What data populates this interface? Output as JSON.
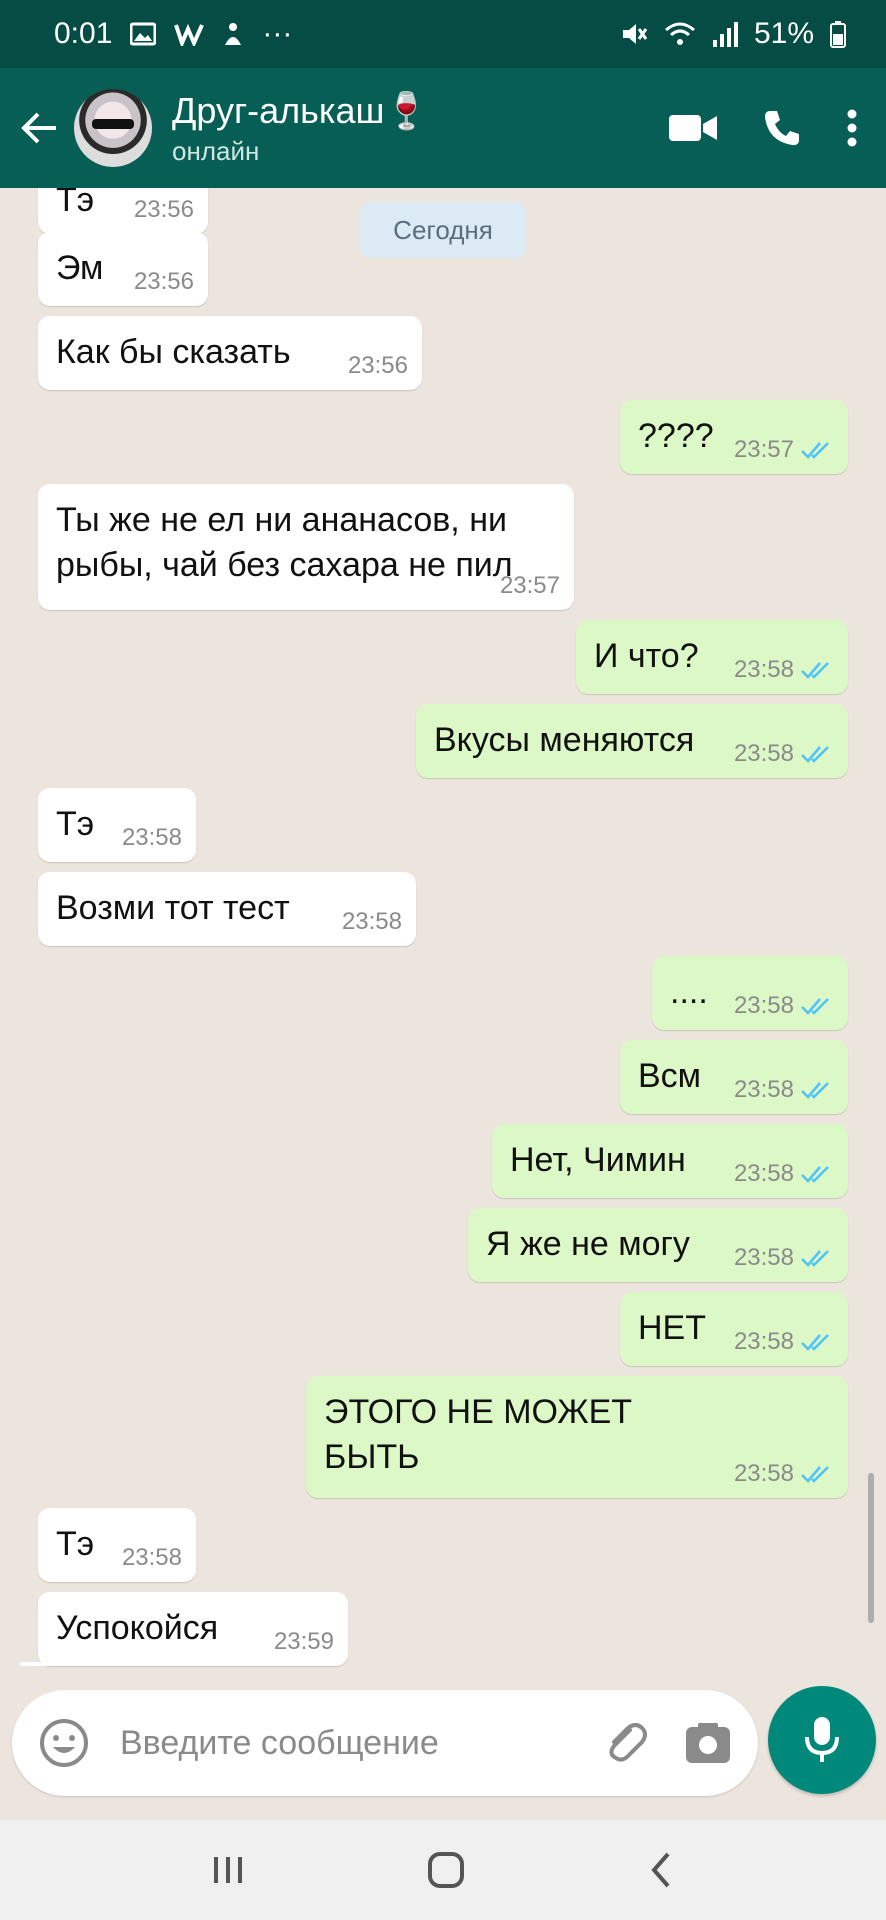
{
  "statusbar": {
    "time": "0:01",
    "battery": "51%",
    "more": "···"
  },
  "header": {
    "name": "Друг-алькаш",
    "name_emoji": "🍷",
    "status": "онлайн"
  },
  "chat": {
    "date_chip": "Сегодня",
    "messages": [
      {
        "dir": "in",
        "text": "Тэ",
        "time": "23:56"
      },
      {
        "dir": "in",
        "text": "Эм",
        "time": "23:56"
      },
      {
        "dir": "in",
        "text": "Как бы сказать",
        "time": "23:56"
      },
      {
        "dir": "out",
        "text": "????",
        "time": "23:57"
      },
      {
        "dir": "in",
        "text": "Ты же не ел ни ананасов, ни\nрыбы, чай без сахара не пил",
        "time": "23:57"
      },
      {
        "dir": "out",
        "text": "И что?",
        "time": "23:58"
      },
      {
        "dir": "out",
        "text": "Вкусы меняются",
        "time": "23:58"
      },
      {
        "dir": "in",
        "text": "Тэ",
        "time": "23:58"
      },
      {
        "dir": "in",
        "text": "Возми тот тест",
        "time": "23:58"
      },
      {
        "dir": "out",
        "text": "....",
        "time": "23:58"
      },
      {
        "dir": "out",
        "text": "Всм",
        "time": "23:58"
      },
      {
        "dir": "out",
        "text": "Нет, Чимин",
        "time": "23:58"
      },
      {
        "dir": "out",
        "text": "Я же не могу",
        "time": "23:58"
      },
      {
        "dir": "out",
        "text": "НЕТ",
        "time": "23:58"
      },
      {
        "dir": "out",
        "text": "ЭТОГО НЕ МОЖЕТ\nБЫТЬ",
        "time": "23:58"
      },
      {
        "dir": "in",
        "text": "Тэ",
        "time": "23:58"
      },
      {
        "dir": "in",
        "text": "Успокойся",
        "time": "23:59"
      }
    ]
  },
  "input": {
    "placeholder": "Введите сообщение"
  },
  "colors": {
    "header": "#075e54",
    "statusbar": "#054d44",
    "outgoing_bubble": "#dcf8c6",
    "incoming_bubble": "#ffffff",
    "read_ticks": "#4fc3f7",
    "mic_button": "#00897b"
  },
  "icons": {
    "back": "arrow-left-icon",
    "video": "video-call-icon",
    "call": "phone-icon",
    "menu": "more-vert-icon",
    "emoji": "emoji-icon",
    "attach": "paperclip-icon",
    "camera": "camera-icon",
    "mic": "microphone-icon",
    "nav_recent": "recent-apps-icon",
    "nav_home": "home-icon",
    "nav_back": "nav-back-icon"
  }
}
